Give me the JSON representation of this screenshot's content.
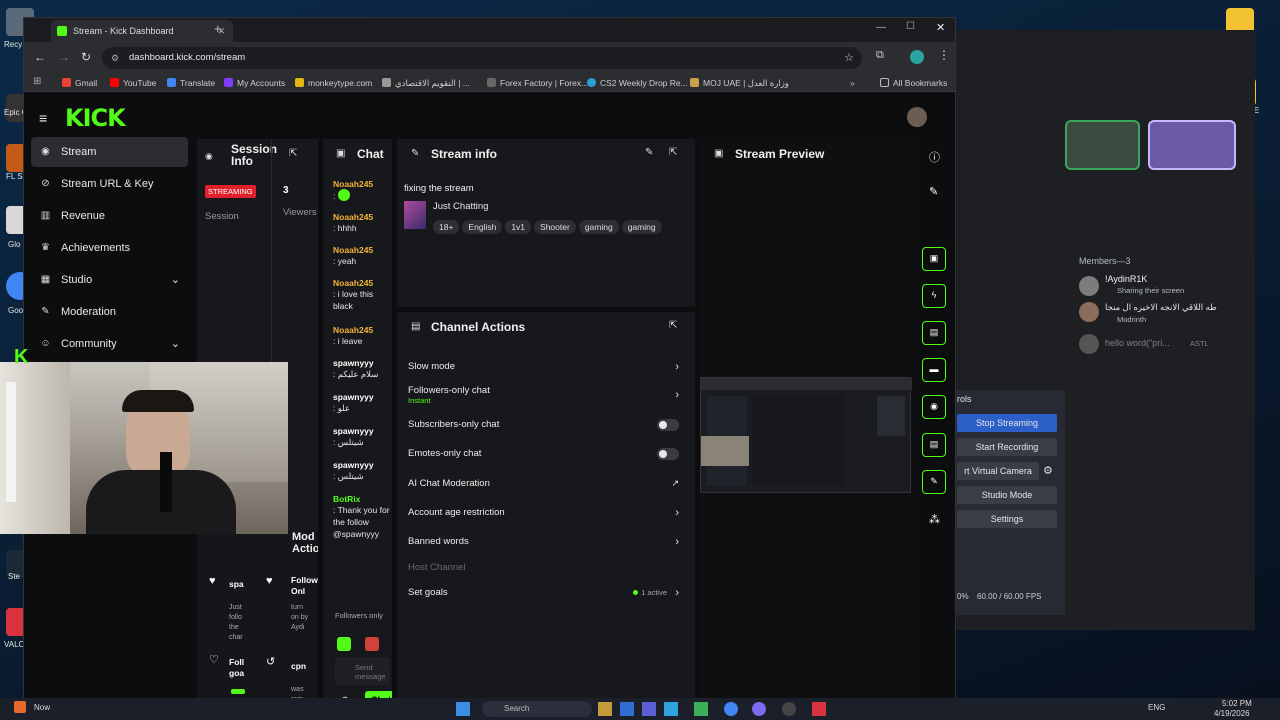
{
  "desktop": {
    "icons": [
      {
        "label": "Recy"
      },
      {
        "label": "Epic G Laun"
      },
      {
        "label": "FL S 20"
      },
      {
        "label": "Glo CO"
      },
      {
        "label": "Goo Chr"
      },
      {
        "label": "Ste"
      },
      {
        "label": "VALO"
      }
    ],
    "right_label": "ALE"
  },
  "chrome": {
    "tab_title": "Stream - Kick Dashboard",
    "url": "dashboard.kick.com/stream",
    "bookmarks": [
      "Gmail",
      "YouTube",
      "Translate",
      "My Accounts",
      "monkeytype.com",
      "التقويم الاقتصادي | ...",
      "Forex Factory | Forex...",
      "CS2 Weekly Drop Re...",
      "MOJ UAE | وزارة العدل",
      "All Bookmarks"
    ]
  },
  "sidebar": {
    "items": [
      {
        "label": "Stream",
        "icon": "broadcast-icon"
      },
      {
        "label": "Stream URL & Key",
        "icon": "link-icon"
      },
      {
        "label": "Revenue",
        "icon": "chart-icon"
      },
      {
        "label": "Achievements",
        "icon": "trophy-icon"
      },
      {
        "label": "Studio",
        "icon": "grid-icon"
      },
      {
        "label": "Moderation",
        "icon": "wrench-icon"
      },
      {
        "label": "Community",
        "icon": "people-icon"
      }
    ]
  },
  "session": {
    "title": "Session Info",
    "streaming_badge": "STREAMING",
    "session_label": "Session",
    "viewers_value": "3",
    "viewers_label": "Viewers"
  },
  "chat": {
    "title": "Chat",
    "messages": [
      {
        "user": "Noaah245",
        "text": ":"
      },
      {
        "user": "Noaah245",
        "text": ": hhhh"
      },
      {
        "user": "Noaah245",
        "text": ": yeah"
      },
      {
        "user": "Noaah245",
        "text": ": i love this black"
      },
      {
        "user": "Noaah245",
        "text": ": i leave"
      },
      {
        "user": "spawnyyy",
        "text": ": سلام عليكم"
      },
      {
        "user": "spawnyyy",
        "text": ": علو"
      },
      {
        "user": "spawnyyy",
        "text": ": شيتلس"
      },
      {
        "user": "spawnyyy",
        "text": ": شيتلس"
      },
      {
        "user": "BotRix",
        "text": ": Thank you for the follow @spawnyyy"
      }
    ],
    "followers_only": "Followers only",
    "send_placeholder": "Send message",
    "chat_button": "Chat"
  },
  "stream_info": {
    "title": "Stream info",
    "stream_title": "fixing the stream",
    "category": "Just Chatting",
    "tags": [
      "18+",
      "English",
      "1v1",
      "Shooter",
      "gaming",
      "gaming"
    ]
  },
  "channel_actions": {
    "title": "Channel Actions",
    "rows": [
      {
        "label": "Slow mode",
        "control": "chevron"
      },
      {
        "label": "Followers-only chat",
        "sub": "Instant",
        "control": "chevron"
      },
      {
        "label": "Subscribers-only chat",
        "control": "toggle"
      },
      {
        "label": "Emotes-only chat",
        "control": "toggle"
      },
      {
        "label": "AI Chat Moderation",
        "control": "external"
      },
      {
        "label": "Account age restriction",
        "control": "chevron"
      },
      {
        "label": "Banned words",
        "control": "chevron"
      },
      {
        "label": "Host Channel",
        "control": "none"
      },
      {
        "label": "Set goals",
        "control": "chevron",
        "status": "1 active"
      }
    ]
  },
  "preview": {
    "title": "Stream Preview"
  },
  "mod_actions": {
    "title": "Mod Actions",
    "items": [
      {
        "a": "spa",
        "b": "Just follo the char"
      },
      {
        "a": "Follow Onl",
        "b": "turn on by Aydi"
      },
      {
        "a": "Foll goa",
        "b": ""
      },
      {
        "a": "cpn",
        "b": "was rem as a"
      }
    ]
  },
  "discord": {
    "members_header": "Members—3",
    "members": [
      {
        "name": "!AydinR1K",
        "sub": "Sharing their screen"
      },
      {
        "name": "طه اللاقي الانجه الاخيره ال منجا",
        "sub": "Modrinth"
      },
      {
        "name": "hello word(\"pri...",
        "sub": "ASTL"
      }
    ]
  },
  "obs": {
    "section": "rols",
    "buttons": [
      "Stop Streaming",
      "Start Recording",
      "rt Virtual Camera",
      "Studio Mode",
      "Settings"
    ],
    "status_pct": "0%",
    "fps": "60.00 / 60.00 FPS"
  },
  "taskbar": {
    "now": "Now",
    "search": "Search",
    "lang": "ENG",
    "time": "5:02 PM",
    "date": "4/19/2026"
  },
  "colors": {
    "kick_green": "#53fc18",
    "streaming_red": "#e0202c",
    "obs_blue": "#2d5fc9"
  }
}
